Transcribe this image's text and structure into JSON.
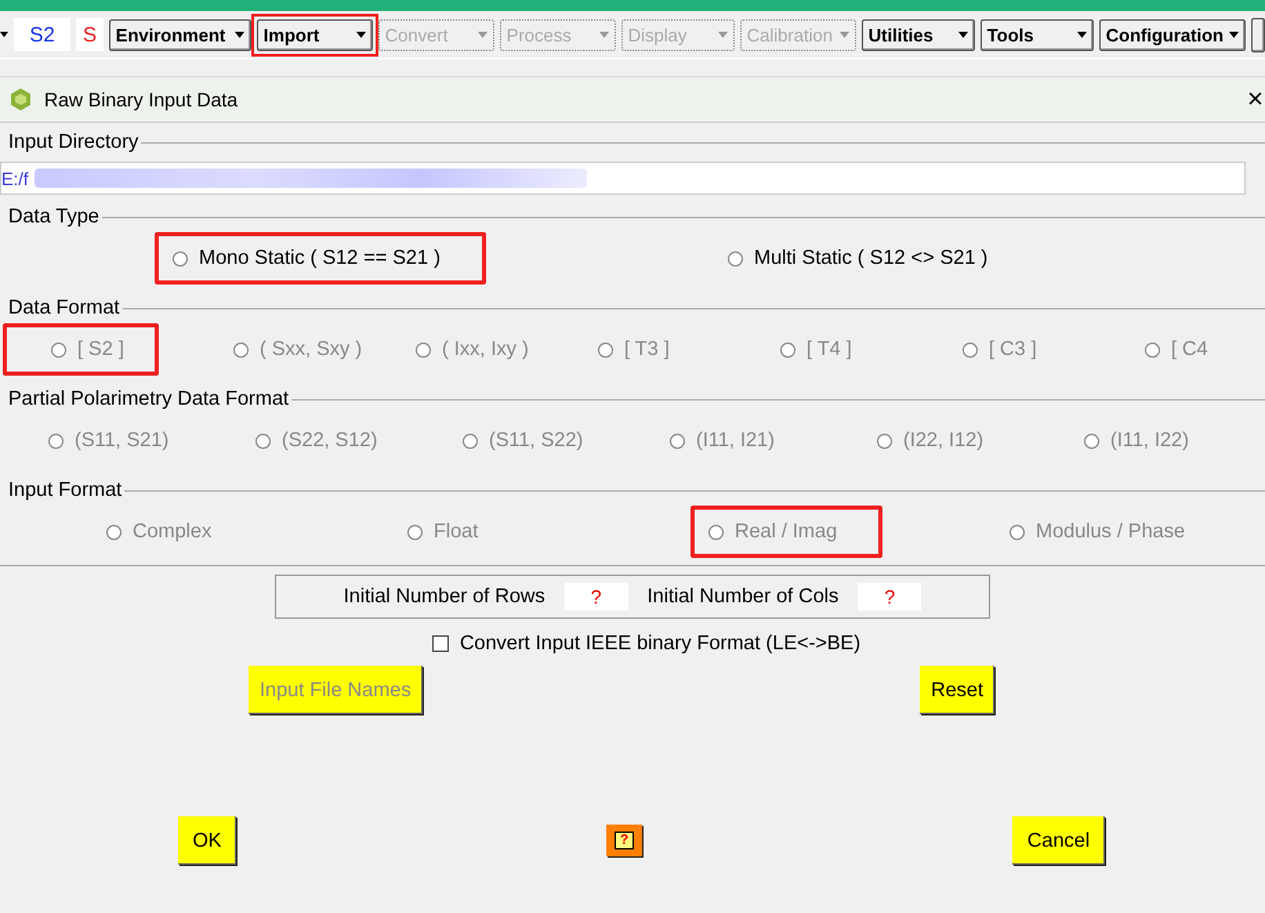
{
  "toolbar": {
    "mode_label": "S2",
    "s_label": "S",
    "menus": [
      {
        "label": "Environment",
        "disabled": false,
        "highlighted": false
      },
      {
        "label": "Import",
        "disabled": false,
        "highlighted": true
      },
      {
        "label": "Convert",
        "disabled": true,
        "highlighted": false
      },
      {
        "label": "Process",
        "disabled": true,
        "highlighted": false
      },
      {
        "label": "Display",
        "disabled": true,
        "highlighted": false
      },
      {
        "label": "Calibration",
        "disabled": true,
        "highlighted": false
      },
      {
        "label": "Utilities",
        "disabled": false,
        "highlighted": false
      },
      {
        "label": "Tools",
        "disabled": false,
        "highlighted": false
      },
      {
        "label": "Configuration",
        "disabled": false,
        "highlighted": false
      }
    ]
  },
  "window": {
    "title": "Raw Binary Input Data",
    "close": "×"
  },
  "input_directory": {
    "title": "Input Directory",
    "value": "E:/f"
  },
  "groups": [
    {
      "title": "Data Type",
      "options": [
        {
          "label": "Mono Static ( S12 == S21 )",
          "selected": false,
          "disabled": false,
          "highlighted": true
        },
        {
          "label": "Multi Static ( S12 <> S21 )",
          "selected": false,
          "disabled": false,
          "highlighted": false
        }
      ]
    },
    {
      "title": "Data Format",
      "options": [
        {
          "label": "[ S2 ]",
          "selected": false,
          "disabled": true,
          "highlighted": true
        },
        {
          "label": "( Sxx, Sxy )",
          "selected": false,
          "disabled": true,
          "highlighted": false
        },
        {
          "label": "( Ixx, Ixy )",
          "selected": false,
          "disabled": true,
          "highlighted": false
        },
        {
          "label": "[ T3 ]",
          "selected": false,
          "disabled": true,
          "highlighted": false
        },
        {
          "label": "[ T4 ]",
          "selected": false,
          "disabled": true,
          "highlighted": false
        },
        {
          "label": "[ C3 ]",
          "selected": false,
          "disabled": true,
          "highlighted": false
        },
        {
          "label": "[ C4",
          "selected": false,
          "disabled": true,
          "highlighted": false
        }
      ]
    },
    {
      "title": "Partial Polarimetry Data Format",
      "options": [
        {
          "label": "(S11, S21)",
          "selected": false,
          "disabled": true,
          "highlighted": false
        },
        {
          "label": "(S22, S12)",
          "selected": false,
          "disabled": true,
          "highlighted": false
        },
        {
          "label": "(S11, S22)",
          "selected": false,
          "disabled": true,
          "highlighted": false
        },
        {
          "label": "(I11, I21)",
          "selected": false,
          "disabled": true,
          "highlighted": false
        },
        {
          "label": "(I22, I12)",
          "selected": false,
          "disabled": true,
          "highlighted": false
        },
        {
          "label": "(I11, I22)",
          "selected": false,
          "disabled": true,
          "highlighted": false
        }
      ]
    },
    {
      "title": "Input Format",
      "options": [
        {
          "label": "Complex",
          "selected": false,
          "disabled": true,
          "highlighted": false
        },
        {
          "label": "Float",
          "selected": false,
          "disabled": true,
          "highlighted": false
        },
        {
          "label": "Real / Imag",
          "selected": false,
          "disabled": true,
          "highlighted": true
        },
        {
          "label": "Modulus / Phase",
          "selected": false,
          "disabled": true,
          "highlighted": false
        }
      ]
    }
  ],
  "size": {
    "rows_label": "Initial Number of Rows",
    "rows_value": "?",
    "cols_label": "Initial Number of Cols",
    "cols_value": "?"
  },
  "convert_checkbox": {
    "label": "Convert Input IEEE binary Format (LE<->BE)",
    "checked": false
  },
  "input_file_names_button": {
    "label": "Input File Names",
    "disabled": true
  },
  "reset_button": {
    "label": "Reset"
  },
  "ok_button": {
    "label": "OK"
  },
  "help_button": {
    "symbol": "?"
  },
  "cancel_button": {
    "label": "Cancel"
  }
}
